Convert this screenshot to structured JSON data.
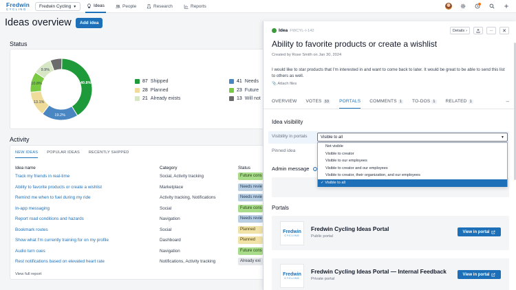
{
  "nav": {
    "logo_line1": "Fredwin",
    "logo_line2": "CYCLING",
    "workspace": "Fredwin Cycling",
    "tabs": [
      {
        "label": "Ideas",
        "icon": "lightbulb-icon",
        "active": true
      },
      {
        "label": "People",
        "icon": "people-icon"
      },
      {
        "label": "Research",
        "icon": "research-icon"
      },
      {
        "label": "Reports",
        "icon": "reports-icon"
      }
    ]
  },
  "page": {
    "title": "Ideas overview",
    "add_label": "Add idea"
  },
  "status": {
    "title": "Status",
    "legend": [
      {
        "count": "87",
        "label": "Shipped",
        "color": "#1e9a3a"
      },
      {
        "count": "28",
        "label": "Planned",
        "color": "#f0dc9a"
      },
      {
        "count": "21",
        "label": "Already exists",
        "color": "#d7e6c5"
      },
      {
        "count": "41",
        "label": "Needs",
        "color": "#4a86c2"
      },
      {
        "count": "23",
        "label": "Future",
        "color": "#7ac943"
      },
      {
        "count": "13",
        "label": "Will not",
        "color": "#6b6b6b"
      }
    ]
  },
  "chart_data": {
    "type": "pie",
    "categories": [
      "Shipped",
      "Needs",
      "Planned",
      "Future",
      "Already exists",
      "Will not"
    ],
    "values": [
      40.8,
      19.2,
      13.1,
      10.8,
      9.9,
      6.1
    ],
    "data_labels": [
      "40.8%",
      "19.2%",
      "13.1%",
      "10.8%",
      "9.9%",
      ""
    ],
    "colors": [
      "#1e9a3a",
      "#4a86c2",
      "#f0dc9a",
      "#7ac943",
      "#d7e6c5",
      "#6b6b6b"
    ]
  },
  "activity": {
    "title": "Activity",
    "tabs": [
      {
        "label": "NEW IDEAS",
        "active": true
      },
      {
        "label": "POPULAR IDEAS"
      },
      {
        "label": "RECENTLY SHIPPED"
      }
    ],
    "headers": {
      "name": "Idea name",
      "category": "Category",
      "status": "Status"
    },
    "rows": [
      {
        "name": "Track my friends in real-time",
        "category": "Social, Activity tracking",
        "status": "Future cons",
        "kind": "fc"
      },
      {
        "name": "Ability to favorite products or create a wishlist",
        "category": "Marketplace",
        "status": "Needs revie",
        "kind": "nr"
      },
      {
        "name": "Remind me when to fuel during my ride",
        "category": "Activity tracking, Notifications",
        "status": "Needs revie",
        "kind": "nr"
      },
      {
        "name": "In-app messaging",
        "category": "Social",
        "status": "Future cons",
        "kind": "fc"
      },
      {
        "name": "Report road conditions and hazards",
        "category": "Navigation",
        "status": "Needs revie",
        "kind": "nr"
      },
      {
        "name": "Bookmark routes",
        "category": "Social",
        "status": "Planned",
        "kind": "pl"
      },
      {
        "name": "Show what I'm currently training for on my profile",
        "category": "Dashboard",
        "status": "Planned",
        "kind": "pl"
      },
      {
        "name": "Audio turn cues",
        "category": "Navigation",
        "status": "Future cons",
        "kind": "fc"
      },
      {
        "name": "Rest notifications based on elevated heart rate",
        "category": "Notifications, Activity tracking",
        "status": "Already exi",
        "kind": "ae"
      }
    ],
    "view_full": "View full report"
  },
  "panel": {
    "type_label": "Idea",
    "ref": "FWCYL-I-142",
    "details_label": "Details",
    "more_label": "···",
    "title": "Ability to favorite products or create a wishlist",
    "created": "Created by Rose Smith on Jan 30, 2024",
    "description": "I would like to star products that I'm interested in and want to come back to later. It would be great to be able to send this list to others as well.",
    "attach": "Attach files",
    "tabs": [
      {
        "label": "OVERVIEW"
      },
      {
        "label": "VOTES",
        "badge": "33"
      },
      {
        "label": "PORTALS",
        "active": true
      },
      {
        "label": "COMMENTS",
        "badge": "1"
      },
      {
        "label": "TO-DOS",
        "badge": "1"
      },
      {
        "label": "RELATED",
        "badge": "1"
      }
    ],
    "visibility_heading": "Idea visibility",
    "visibility_label": "Visibility in portals",
    "visibility_value": "Visible to all",
    "pinned_label": "Pinned idea",
    "admin_label": "Admin message",
    "options": [
      "Not visible",
      "Visible to creator",
      "Visible to our employees",
      "Visible to creator and our employees",
      "Visible to creator, their organization, and our employees",
      "Visible to all"
    ],
    "selected_option": 5,
    "portals_heading": "Portals",
    "portals": [
      {
        "name": "Fredwin Cycling Ideas Portal",
        "kind": "Public portal",
        "button": "View in portal"
      },
      {
        "name": "Fredwin Cycling Ideas Portal — Internal Feedback",
        "kind": "Private portal",
        "button": "View in portal"
      }
    ]
  }
}
